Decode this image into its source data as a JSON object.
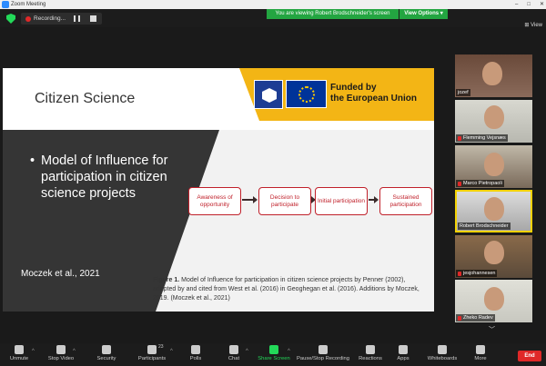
{
  "window": {
    "title": "Zoom Meeting"
  },
  "topbar": {
    "recording_label": "Recording...",
    "viewing_banner": "You are viewing Robert Brodschneider's screen",
    "view_options": "View Options ▾",
    "view_label": "View"
  },
  "slide": {
    "title": "Citizen Science",
    "funded": "Funded by\nthe European Union",
    "bullet": "Model of Influence for participation in citizen science projects",
    "citation": "Moczek et al., 2021",
    "flow": [
      "Awareness of opportunity",
      "Decision to participate",
      "Initial participation",
      "Sustained participation"
    ],
    "caption_bold": "Figure 1.",
    "caption_text": " Model of Influence for participation in citizen science projects by Penner (2002), adapted by and cited from West et al. (2016) in Geoghegan et al. (2016). Additions by Moczek, 2019. (Moczek et al., 2021)"
  },
  "participants": [
    {
      "name": "jozef",
      "muted": false
    },
    {
      "name": "Flemming Vejsnæs",
      "muted": true
    },
    {
      "name": "Marco Pietropaoli",
      "muted": true
    },
    {
      "name": "Robert Brodschneider",
      "muted": false,
      "active": true
    },
    {
      "name": "jesjohannesen",
      "muted": true
    },
    {
      "name": "Zheko Radev",
      "muted": true
    }
  ],
  "toolbar": {
    "unmute": "Unmute",
    "stop_video": "Stop Video",
    "security": "Security",
    "participants": "Participants",
    "participants_count": "23",
    "polls": "Polls",
    "chat": "Chat",
    "share_screen": "Share Screen",
    "pause_recording": "Pause/Stop Recording",
    "reactions": "Reactions",
    "apps": "Apps",
    "whiteboards": "Whiteboards",
    "more": "More",
    "end": "End"
  },
  "colors": {
    "share_green": "#23d959",
    "banner_green": "#23a541",
    "end_red": "#e02828",
    "active_tile": "#f2d100",
    "flow_red": "#c0202a",
    "eu_yellow": "#f3b515"
  }
}
